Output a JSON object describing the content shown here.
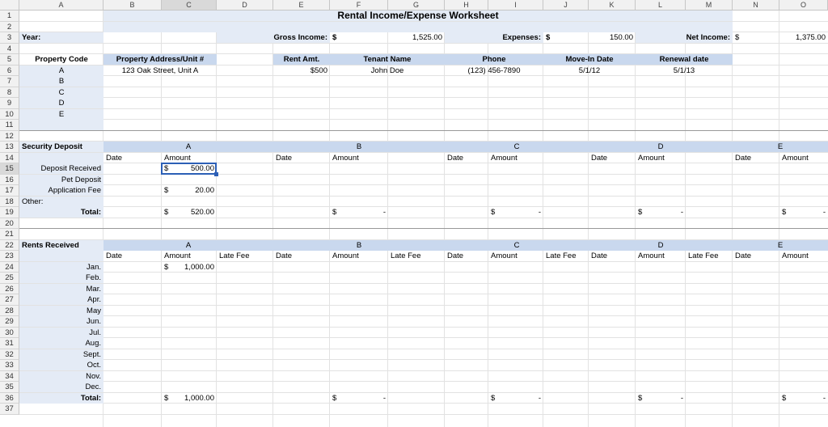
{
  "columns": [
    "A",
    "B",
    "C",
    "D",
    "E",
    "F",
    "G",
    "H",
    "I",
    "J",
    "K",
    "L",
    "M",
    "N",
    "O"
  ],
  "rows": [
    "1",
    "2",
    "3",
    "4",
    "5",
    "6",
    "7",
    "8",
    "9",
    "10",
    "11",
    "12",
    "13",
    "14",
    "15",
    "16",
    "17",
    "18",
    "19",
    "20",
    "21",
    "22",
    "23",
    "24",
    "25",
    "26",
    "27",
    "28",
    "29",
    "30",
    "31",
    "32",
    "33",
    "34",
    "35",
    "36",
    "37"
  ],
  "title": "Rental Income/Expense Worksheet",
  "summary": {
    "year_label": "Year:",
    "gross_label": "Gross Income:",
    "gross_currency": "$",
    "gross_value": "1,525.00",
    "expenses_label": "Expenses:",
    "expenses_currency": "$",
    "expenses_value": "150.00",
    "net_label": "Net Income:",
    "net_currency": "$",
    "net_value": "1,375.00"
  },
  "property_table": {
    "headers": [
      "Property Code",
      "Property Address/Unit #",
      "Rent Amt.",
      "Tenant Name",
      "Phone",
      "Move-In Date",
      "Renewal date"
    ],
    "codes": [
      "A",
      "B",
      "C",
      "D",
      "E"
    ],
    "row_a": {
      "address": "123 Oak Street, Unit A",
      "rent": "$500",
      "tenant": "John Doe",
      "phone": "(123) 456-7890",
      "move_in": "5/1/12",
      "renewal": "5/1/13"
    }
  },
  "security": {
    "label": "Security Deposit",
    "groups": [
      "A",
      "B",
      "C",
      "D",
      "E"
    ],
    "date_label": "Date",
    "amount_label": "Amount",
    "rows": [
      "Deposit Received",
      "Pet Deposit",
      "Application Fee"
    ],
    "other_label": "Other:",
    "total_label": "Total:",
    "deposit_a": "500.00",
    "application_a": "20.00",
    "total_a": "520.00",
    "currency": "$",
    "dash": "-"
  },
  "rents": {
    "label": "Rents Received",
    "groups": [
      "A",
      "B",
      "C",
      "D",
      "E"
    ],
    "date_label": "Date",
    "amount_label": "Amount",
    "late_label": "Late Fee",
    "months": [
      "Jan.",
      "Feb.",
      "Mar.",
      "Apr.",
      "May",
      "Jun.",
      "Jul.",
      "Aug.",
      "Sept.",
      "Oct.",
      "Nov.",
      "Dec."
    ],
    "jan_a": "1,000.00",
    "total_label": "Total:",
    "total_a": "1,000.00",
    "currency": "$",
    "dash": "-"
  }
}
